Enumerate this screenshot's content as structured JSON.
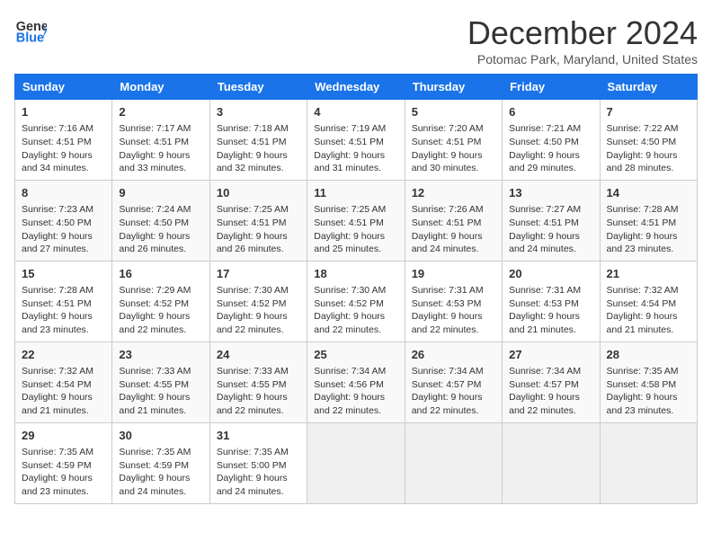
{
  "header": {
    "logo_line1": "General",
    "logo_line2": "Blue",
    "month_title": "December 2024",
    "location": "Potomac Park, Maryland, United States"
  },
  "weekdays": [
    "Sunday",
    "Monday",
    "Tuesday",
    "Wednesday",
    "Thursday",
    "Friday",
    "Saturday"
  ],
  "weeks": [
    [
      {
        "day": "1",
        "info": "Sunrise: 7:16 AM\nSunset: 4:51 PM\nDaylight: 9 hours\nand 34 minutes."
      },
      {
        "day": "2",
        "info": "Sunrise: 7:17 AM\nSunset: 4:51 PM\nDaylight: 9 hours\nand 33 minutes."
      },
      {
        "day": "3",
        "info": "Sunrise: 7:18 AM\nSunset: 4:51 PM\nDaylight: 9 hours\nand 32 minutes."
      },
      {
        "day": "4",
        "info": "Sunrise: 7:19 AM\nSunset: 4:51 PM\nDaylight: 9 hours\nand 31 minutes."
      },
      {
        "day": "5",
        "info": "Sunrise: 7:20 AM\nSunset: 4:51 PM\nDaylight: 9 hours\nand 30 minutes."
      },
      {
        "day": "6",
        "info": "Sunrise: 7:21 AM\nSunset: 4:50 PM\nDaylight: 9 hours\nand 29 minutes."
      },
      {
        "day": "7",
        "info": "Sunrise: 7:22 AM\nSunset: 4:50 PM\nDaylight: 9 hours\nand 28 minutes."
      }
    ],
    [
      {
        "day": "8",
        "info": "Sunrise: 7:23 AM\nSunset: 4:50 PM\nDaylight: 9 hours\nand 27 minutes."
      },
      {
        "day": "9",
        "info": "Sunrise: 7:24 AM\nSunset: 4:50 PM\nDaylight: 9 hours\nand 26 minutes."
      },
      {
        "day": "10",
        "info": "Sunrise: 7:25 AM\nSunset: 4:51 PM\nDaylight: 9 hours\nand 26 minutes."
      },
      {
        "day": "11",
        "info": "Sunrise: 7:25 AM\nSunset: 4:51 PM\nDaylight: 9 hours\nand 25 minutes."
      },
      {
        "day": "12",
        "info": "Sunrise: 7:26 AM\nSunset: 4:51 PM\nDaylight: 9 hours\nand 24 minutes."
      },
      {
        "day": "13",
        "info": "Sunrise: 7:27 AM\nSunset: 4:51 PM\nDaylight: 9 hours\nand 24 minutes."
      },
      {
        "day": "14",
        "info": "Sunrise: 7:28 AM\nSunset: 4:51 PM\nDaylight: 9 hours\nand 23 minutes."
      }
    ],
    [
      {
        "day": "15",
        "info": "Sunrise: 7:28 AM\nSunset: 4:51 PM\nDaylight: 9 hours\nand 23 minutes."
      },
      {
        "day": "16",
        "info": "Sunrise: 7:29 AM\nSunset: 4:52 PM\nDaylight: 9 hours\nand 22 minutes."
      },
      {
        "day": "17",
        "info": "Sunrise: 7:30 AM\nSunset: 4:52 PM\nDaylight: 9 hours\nand 22 minutes."
      },
      {
        "day": "18",
        "info": "Sunrise: 7:30 AM\nSunset: 4:52 PM\nDaylight: 9 hours\nand 22 minutes."
      },
      {
        "day": "19",
        "info": "Sunrise: 7:31 AM\nSunset: 4:53 PM\nDaylight: 9 hours\nand 22 minutes."
      },
      {
        "day": "20",
        "info": "Sunrise: 7:31 AM\nSunset: 4:53 PM\nDaylight: 9 hours\nand 21 minutes."
      },
      {
        "day": "21",
        "info": "Sunrise: 7:32 AM\nSunset: 4:54 PM\nDaylight: 9 hours\nand 21 minutes."
      }
    ],
    [
      {
        "day": "22",
        "info": "Sunrise: 7:32 AM\nSunset: 4:54 PM\nDaylight: 9 hours\nand 21 minutes."
      },
      {
        "day": "23",
        "info": "Sunrise: 7:33 AM\nSunset: 4:55 PM\nDaylight: 9 hours\nand 21 minutes."
      },
      {
        "day": "24",
        "info": "Sunrise: 7:33 AM\nSunset: 4:55 PM\nDaylight: 9 hours\nand 22 minutes."
      },
      {
        "day": "25",
        "info": "Sunrise: 7:34 AM\nSunset: 4:56 PM\nDaylight: 9 hours\nand 22 minutes."
      },
      {
        "day": "26",
        "info": "Sunrise: 7:34 AM\nSunset: 4:57 PM\nDaylight: 9 hours\nand 22 minutes."
      },
      {
        "day": "27",
        "info": "Sunrise: 7:34 AM\nSunset: 4:57 PM\nDaylight: 9 hours\nand 22 minutes."
      },
      {
        "day": "28",
        "info": "Sunrise: 7:35 AM\nSunset: 4:58 PM\nDaylight: 9 hours\nand 23 minutes."
      }
    ],
    [
      {
        "day": "29",
        "info": "Sunrise: 7:35 AM\nSunset: 4:59 PM\nDaylight: 9 hours\nand 23 minutes."
      },
      {
        "day": "30",
        "info": "Sunrise: 7:35 AM\nSunset: 4:59 PM\nDaylight: 9 hours\nand 24 minutes."
      },
      {
        "day": "31",
        "info": "Sunrise: 7:35 AM\nSunset: 5:00 PM\nDaylight: 9 hours\nand 24 minutes."
      },
      {
        "day": "",
        "info": ""
      },
      {
        "day": "",
        "info": ""
      },
      {
        "day": "",
        "info": ""
      },
      {
        "day": "",
        "info": ""
      }
    ]
  ]
}
